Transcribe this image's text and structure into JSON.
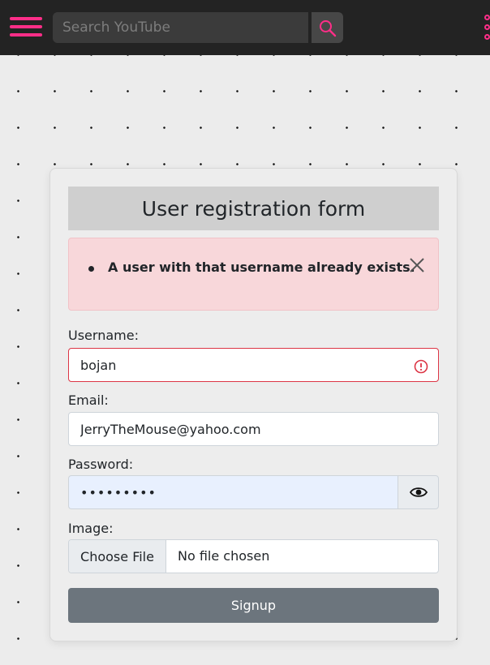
{
  "header": {
    "menu_icon": "hamburger-menu-icon",
    "search_placeholder": "Search YouTube",
    "search_icon": "search-icon",
    "more_icon": "kebab-menu-icon",
    "accent_color": "#ff2e88"
  },
  "form": {
    "title": "User registration form",
    "alert": {
      "messages": [
        "A user with that username already exists."
      ],
      "close_icon": "close-icon"
    },
    "username": {
      "label": "Username:",
      "value": "bojan",
      "status_icon": "error-icon"
    },
    "email": {
      "label": "Email:",
      "value": "JerryTheMouse@yahoo.com"
    },
    "password": {
      "label": "Password:",
      "value": "•••••••••",
      "toggle_icon": "eye-icon"
    },
    "image": {
      "label": "Image:",
      "button_label": "Choose File",
      "status": "No file chosen"
    },
    "submit_label": "Signup"
  },
  "colors": {
    "error": "#dc3545",
    "alert_bg": "#f8d7da",
    "button": "#6c757d"
  }
}
